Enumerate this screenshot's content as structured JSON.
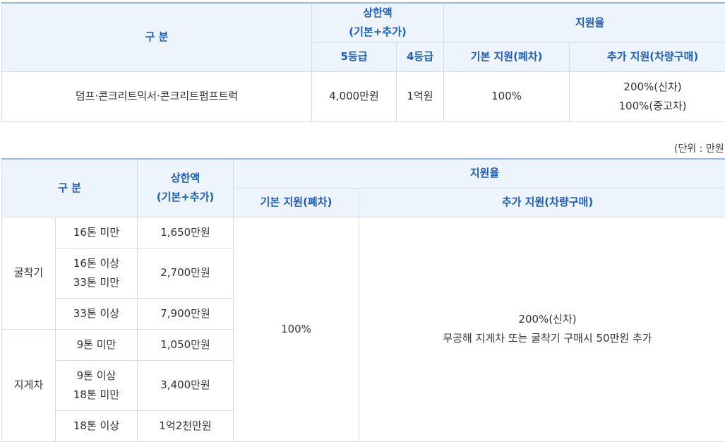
{
  "table1": {
    "header": {
      "category": "구 분",
      "limit": "상한액",
      "limit_sub": "(기본+추가)",
      "grade5": "5등급",
      "grade4": "4등급",
      "rate": "지원율",
      "basic": "기본 지원(폐차)",
      "extra": "추가 지원(차량구매)"
    },
    "row": {
      "category": "덤프·콘크리트믹서·콘크리트펌프트럭",
      "grade5": "4,000만원",
      "grade4": "1억원",
      "basic": "100%",
      "extra_1": "200%(신차)",
      "extra_2": "100%(중고차)"
    }
  },
  "unit_note": "(단위 : 만원)",
  "table2": {
    "header": {
      "category": "구 분",
      "limit": "상한액",
      "limit_sub": "(기본+추가)",
      "rate": "지원율",
      "basic": "기본 지원(폐차)",
      "extra": "추가 지원(차량구매)"
    },
    "groups": [
      {
        "name": "굴착기",
        "rows": [
          {
            "size_1": "16톤 미만",
            "size_2": "",
            "limit": "1,650만원"
          },
          {
            "size_1": "16톤 이상",
            "size_2": "33톤 미만",
            "limit": "2,700만원"
          },
          {
            "size_1": "33톤 이상",
            "size_2": "",
            "limit": "7,900만원"
          }
        ]
      },
      {
        "name": "지게차",
        "rows": [
          {
            "size_1": "9톤 미만",
            "size_2": "",
            "limit": "1,050만원"
          },
          {
            "size_1": "9톤 이상",
            "size_2": "18톤 미만",
            "limit": "3,400만원"
          },
          {
            "size_1": "18톤 이상",
            "size_2": "",
            "limit": "1억2천만원"
          }
        ]
      }
    ],
    "basic": "100%",
    "extra_1": "200%(신차)",
    "extra_2": "무공해 지게차 또는 굴착기 구매시 50만원 추가"
  }
}
